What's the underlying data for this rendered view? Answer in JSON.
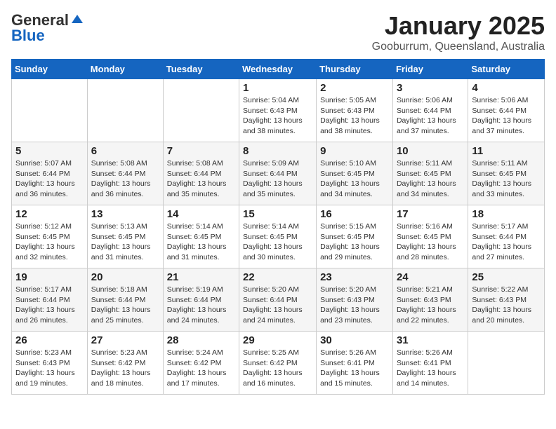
{
  "logo": {
    "general": "General",
    "blue": "Blue"
  },
  "header": {
    "month": "January 2025",
    "location": "Gooburrum, Queensland, Australia"
  },
  "weekdays": [
    "Sunday",
    "Monday",
    "Tuesday",
    "Wednesday",
    "Thursday",
    "Friday",
    "Saturday"
  ],
  "weeks": [
    [
      {
        "day": "",
        "info": ""
      },
      {
        "day": "",
        "info": ""
      },
      {
        "day": "",
        "info": ""
      },
      {
        "day": "1",
        "info": "Sunrise: 5:04 AM\nSunset: 6:43 PM\nDaylight: 13 hours\nand 38 minutes."
      },
      {
        "day": "2",
        "info": "Sunrise: 5:05 AM\nSunset: 6:43 PM\nDaylight: 13 hours\nand 38 minutes."
      },
      {
        "day": "3",
        "info": "Sunrise: 5:06 AM\nSunset: 6:44 PM\nDaylight: 13 hours\nand 37 minutes."
      },
      {
        "day": "4",
        "info": "Sunrise: 5:06 AM\nSunset: 6:44 PM\nDaylight: 13 hours\nand 37 minutes."
      }
    ],
    [
      {
        "day": "5",
        "info": "Sunrise: 5:07 AM\nSunset: 6:44 PM\nDaylight: 13 hours\nand 36 minutes."
      },
      {
        "day": "6",
        "info": "Sunrise: 5:08 AM\nSunset: 6:44 PM\nDaylight: 13 hours\nand 36 minutes."
      },
      {
        "day": "7",
        "info": "Sunrise: 5:08 AM\nSunset: 6:44 PM\nDaylight: 13 hours\nand 35 minutes."
      },
      {
        "day": "8",
        "info": "Sunrise: 5:09 AM\nSunset: 6:44 PM\nDaylight: 13 hours\nand 35 minutes."
      },
      {
        "day": "9",
        "info": "Sunrise: 5:10 AM\nSunset: 6:45 PM\nDaylight: 13 hours\nand 34 minutes."
      },
      {
        "day": "10",
        "info": "Sunrise: 5:11 AM\nSunset: 6:45 PM\nDaylight: 13 hours\nand 34 minutes."
      },
      {
        "day": "11",
        "info": "Sunrise: 5:11 AM\nSunset: 6:45 PM\nDaylight: 13 hours\nand 33 minutes."
      }
    ],
    [
      {
        "day": "12",
        "info": "Sunrise: 5:12 AM\nSunset: 6:45 PM\nDaylight: 13 hours\nand 32 minutes."
      },
      {
        "day": "13",
        "info": "Sunrise: 5:13 AM\nSunset: 6:45 PM\nDaylight: 13 hours\nand 31 minutes."
      },
      {
        "day": "14",
        "info": "Sunrise: 5:14 AM\nSunset: 6:45 PM\nDaylight: 13 hours\nand 31 minutes."
      },
      {
        "day": "15",
        "info": "Sunrise: 5:14 AM\nSunset: 6:45 PM\nDaylight: 13 hours\nand 30 minutes."
      },
      {
        "day": "16",
        "info": "Sunrise: 5:15 AM\nSunset: 6:45 PM\nDaylight: 13 hours\nand 29 minutes."
      },
      {
        "day": "17",
        "info": "Sunrise: 5:16 AM\nSunset: 6:45 PM\nDaylight: 13 hours\nand 28 minutes."
      },
      {
        "day": "18",
        "info": "Sunrise: 5:17 AM\nSunset: 6:44 PM\nDaylight: 13 hours\nand 27 minutes."
      }
    ],
    [
      {
        "day": "19",
        "info": "Sunrise: 5:17 AM\nSunset: 6:44 PM\nDaylight: 13 hours\nand 26 minutes."
      },
      {
        "day": "20",
        "info": "Sunrise: 5:18 AM\nSunset: 6:44 PM\nDaylight: 13 hours\nand 25 minutes."
      },
      {
        "day": "21",
        "info": "Sunrise: 5:19 AM\nSunset: 6:44 PM\nDaylight: 13 hours\nand 24 minutes."
      },
      {
        "day": "22",
        "info": "Sunrise: 5:20 AM\nSunset: 6:44 PM\nDaylight: 13 hours\nand 24 minutes."
      },
      {
        "day": "23",
        "info": "Sunrise: 5:20 AM\nSunset: 6:43 PM\nDaylight: 13 hours\nand 23 minutes."
      },
      {
        "day": "24",
        "info": "Sunrise: 5:21 AM\nSunset: 6:43 PM\nDaylight: 13 hours\nand 22 minutes."
      },
      {
        "day": "25",
        "info": "Sunrise: 5:22 AM\nSunset: 6:43 PM\nDaylight: 13 hours\nand 20 minutes."
      }
    ],
    [
      {
        "day": "26",
        "info": "Sunrise: 5:23 AM\nSunset: 6:43 PM\nDaylight: 13 hours\nand 19 minutes."
      },
      {
        "day": "27",
        "info": "Sunrise: 5:23 AM\nSunset: 6:42 PM\nDaylight: 13 hours\nand 18 minutes."
      },
      {
        "day": "28",
        "info": "Sunrise: 5:24 AM\nSunset: 6:42 PM\nDaylight: 13 hours\nand 17 minutes."
      },
      {
        "day": "29",
        "info": "Sunrise: 5:25 AM\nSunset: 6:42 PM\nDaylight: 13 hours\nand 16 minutes."
      },
      {
        "day": "30",
        "info": "Sunrise: 5:26 AM\nSunset: 6:41 PM\nDaylight: 13 hours\nand 15 minutes."
      },
      {
        "day": "31",
        "info": "Sunrise: 5:26 AM\nSunset: 6:41 PM\nDaylight: 13 hours\nand 14 minutes."
      },
      {
        "day": "",
        "info": ""
      }
    ]
  ]
}
